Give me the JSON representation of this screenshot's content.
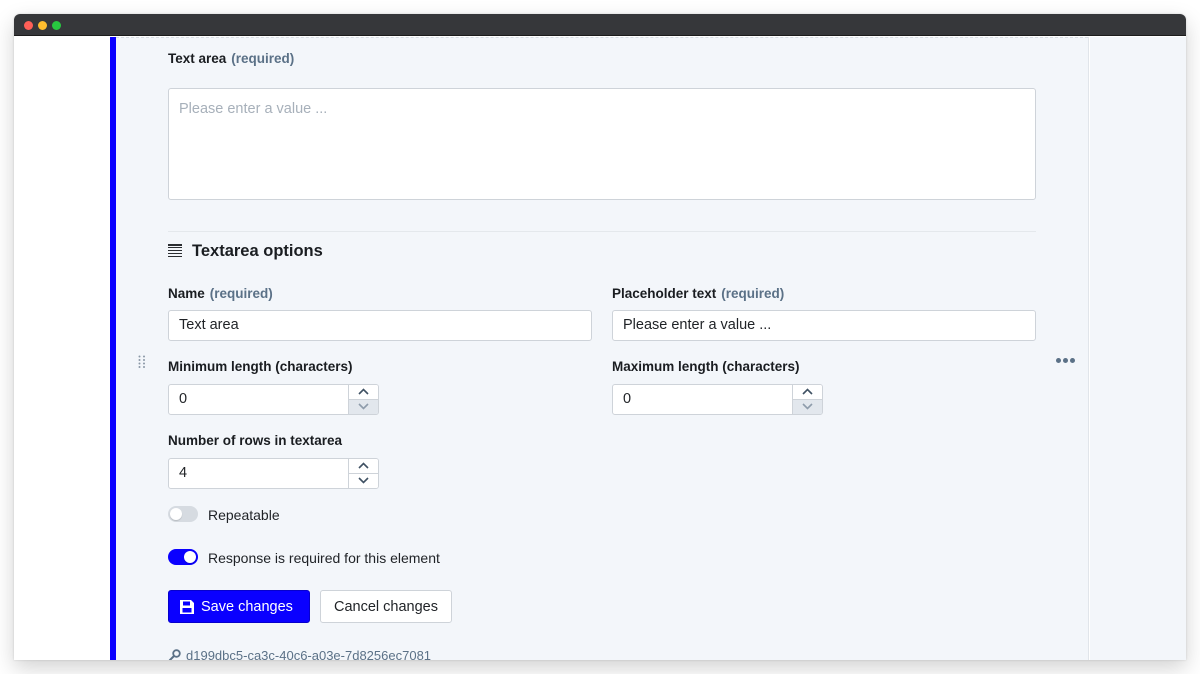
{
  "window": {
    "controls": [
      "close",
      "minimize",
      "maximize"
    ]
  },
  "element": {
    "preview_label": "Text area",
    "preview_required": "(required)",
    "preview_placeholder": "Please enter a value ..."
  },
  "options": {
    "title": "Textarea options",
    "title_icon": "text-lines-icon",
    "name": {
      "label": "Name",
      "required": "(required)",
      "value": "Text area"
    },
    "placeholder": {
      "label": "Placeholder text",
      "required": "(required)",
      "value": "Please enter a value ..."
    },
    "min_length": {
      "label": "Minimum length (characters)",
      "value": "0"
    },
    "max_length": {
      "label": "Maximum length (characters)",
      "value": "0"
    },
    "rows": {
      "label": "Number of rows in textarea",
      "value": "4"
    },
    "repeatable": {
      "label": "Repeatable",
      "checked": false
    },
    "required_toggle": {
      "label": "Response is required for this element",
      "checked": true
    }
  },
  "actions": {
    "save_label": "Save changes",
    "cancel_label": "Cancel changes"
  },
  "element_id": "d199dbc5-ca3c-40c6-a03e-7d8256ec7081",
  "colors": {
    "accent": "#0a00ff",
    "required_text": "#5b7187",
    "panel_bg": "#f3f6fa"
  }
}
